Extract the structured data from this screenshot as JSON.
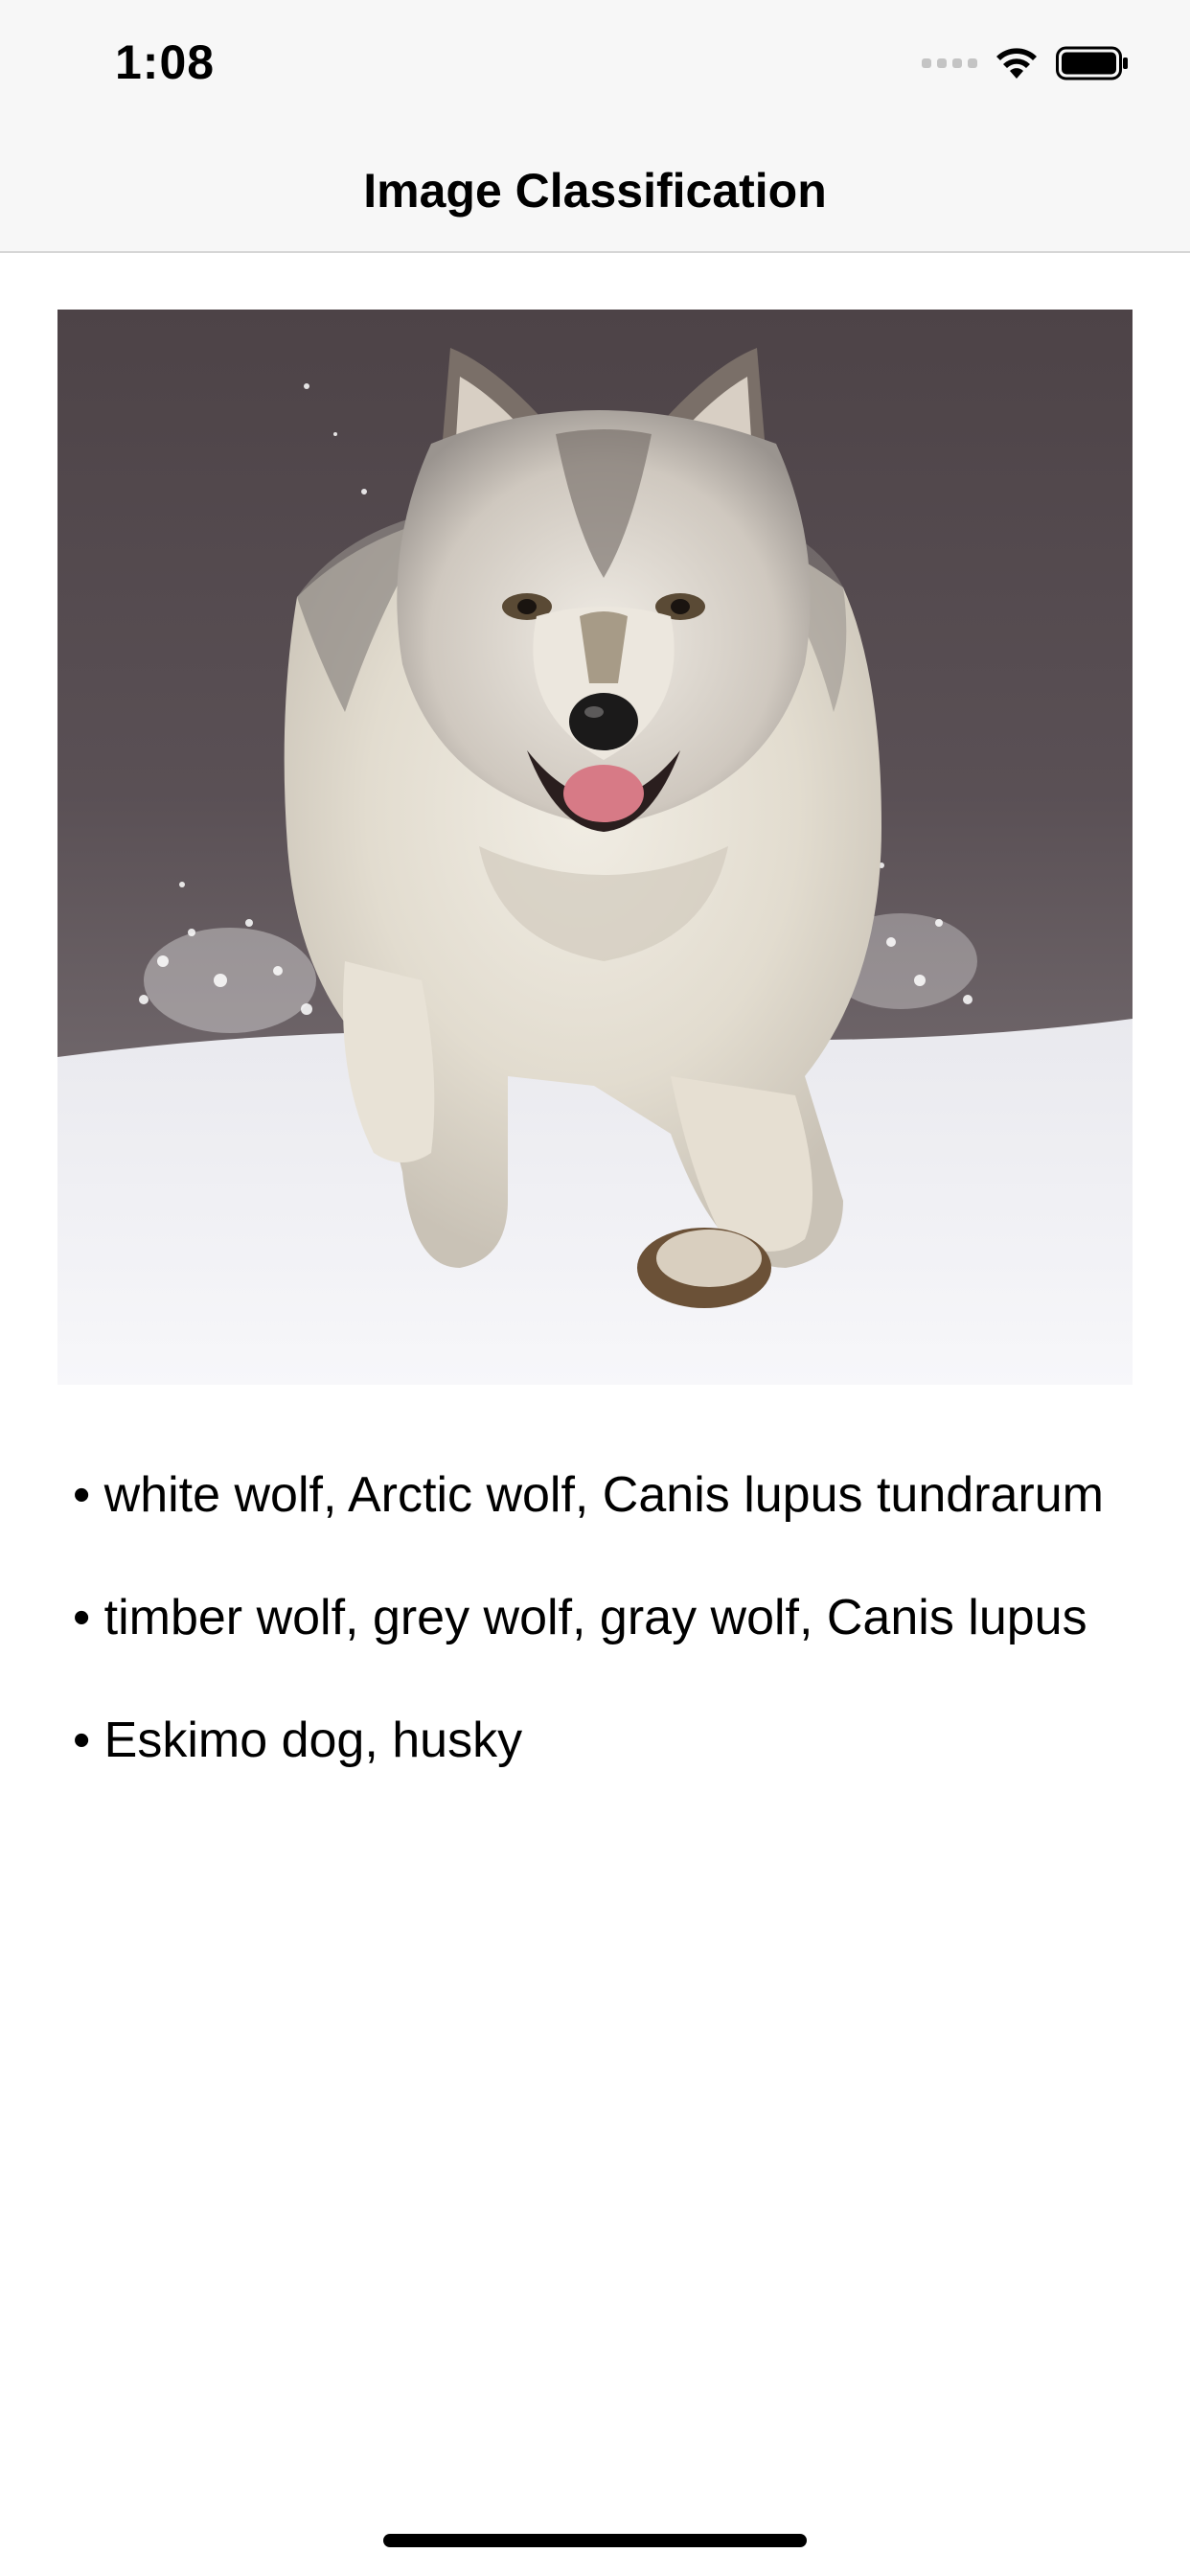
{
  "status_bar": {
    "time": "1:08",
    "icons": [
      "signal-icon",
      "wifi-icon",
      "battery-icon"
    ]
  },
  "nav": {
    "title": "Image Classification"
  },
  "photo": {
    "subject": "wolf-photo"
  },
  "results": [
    {
      "label": "• white wolf, Arctic wolf, Canis lupus tundrarum"
    },
    {
      "label": "• timber wolf, grey wolf, gray wolf, Canis lupus"
    },
    {
      "label": "• Eskimo dog, husky"
    }
  ]
}
